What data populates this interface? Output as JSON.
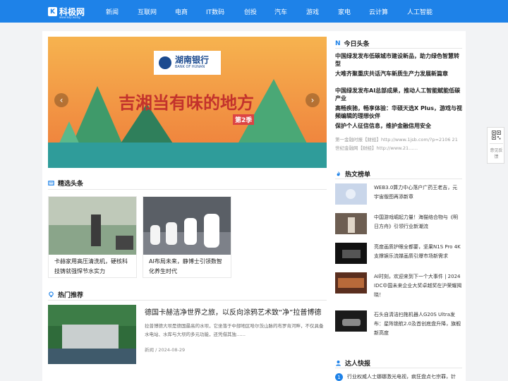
{
  "header": {
    "logo_mark": "K",
    "logo_text": "科极网",
    "logo_sub": "www.keji.wang",
    "nav": [
      "新闻",
      "互联网",
      "电商",
      "IT数码",
      "创投",
      "汽车",
      "游戏",
      "家电",
      "云计算",
      "人工智能"
    ]
  },
  "slider": {
    "prev": "‹",
    "next": "›",
    "bank_name": "湖南银行",
    "bank_en": "BANK OF HUNAN",
    "show_title": "吉湘当有味的地方",
    "season": "第2季"
  },
  "featured": {
    "title": "精选头条",
    "items": [
      {
        "caption": "卡赫家用高压清洗机，硬核科技铸就强悍节水实力"
      },
      {
        "caption": "AI布局未来，静博士引领数智化养生时代"
      }
    ]
  },
  "hot": {
    "title": "热门推荐",
    "article": {
      "title": "德国卡赫洁净世界之旅，以反向涂鸦艺术致“净”拉普博德",
      "desc": "拉普博德大坝是德国最高的水坝，它坐落于中部地区哈尔茨山脉的布罗肯河畔，不仅具备水电站、水库与大坝的多元功能，还凭借其独……",
      "meta": "新闻 / 2024-08-29"
    }
  },
  "today": {
    "title": "今日头条",
    "items": [
      "中国绿发发布低碳城市建设新品，助力绿色智慧转型",
      "大唯齐聚重庆共话汽车新质生产力发展新篇章",
      "中国绿发发布AI总部成果，推动人工智能赋能低碳产业",
      "高畅疾驰，畅享体验：华硕天选X Plus，游戏与视频编辑的理想伙伴",
      "保护个人征信信息，维护金融信用安全"
    ],
    "note": "第一金融时报【财经】http://www.1jsb.com/?p=2106 21世纪金融网【财经】http://www.21……"
  },
  "hotlist": {
    "title": "热文榜单",
    "items": [
      "WEB3.0算力中心落户广药王老吉，元宇宙版图再添新章",
      "中国游戏崛起力量！海猫络合物与《明日方舟》引领行业新潮流",
      "亮度画质护眼全都要，坚果N1S Pro 4K支撑娱乐流媒画质引爆市场新需求",
      "AI时刻，欢迎来到下一个大事件 | 2024 IDC中国未来企业大奖卓越奖在沪荣耀揭晓！",
      "石头自清洁扫拖机器人G20S Ultra发布：星阵锁航2.0及首创底盘升降，旗舰新高度"
    ]
  },
  "experts": {
    "title": "达人快报",
    "first_num": "1",
    "first": "行业权威人士娜娜激光电视，疯狂盘点七宗罪，针"
  },
  "side_tools": {
    "feedback": "意见反馈"
  },
  "colors": {
    "brand": "#1e82e8",
    "page_bg": "#f2f3f5"
  }
}
